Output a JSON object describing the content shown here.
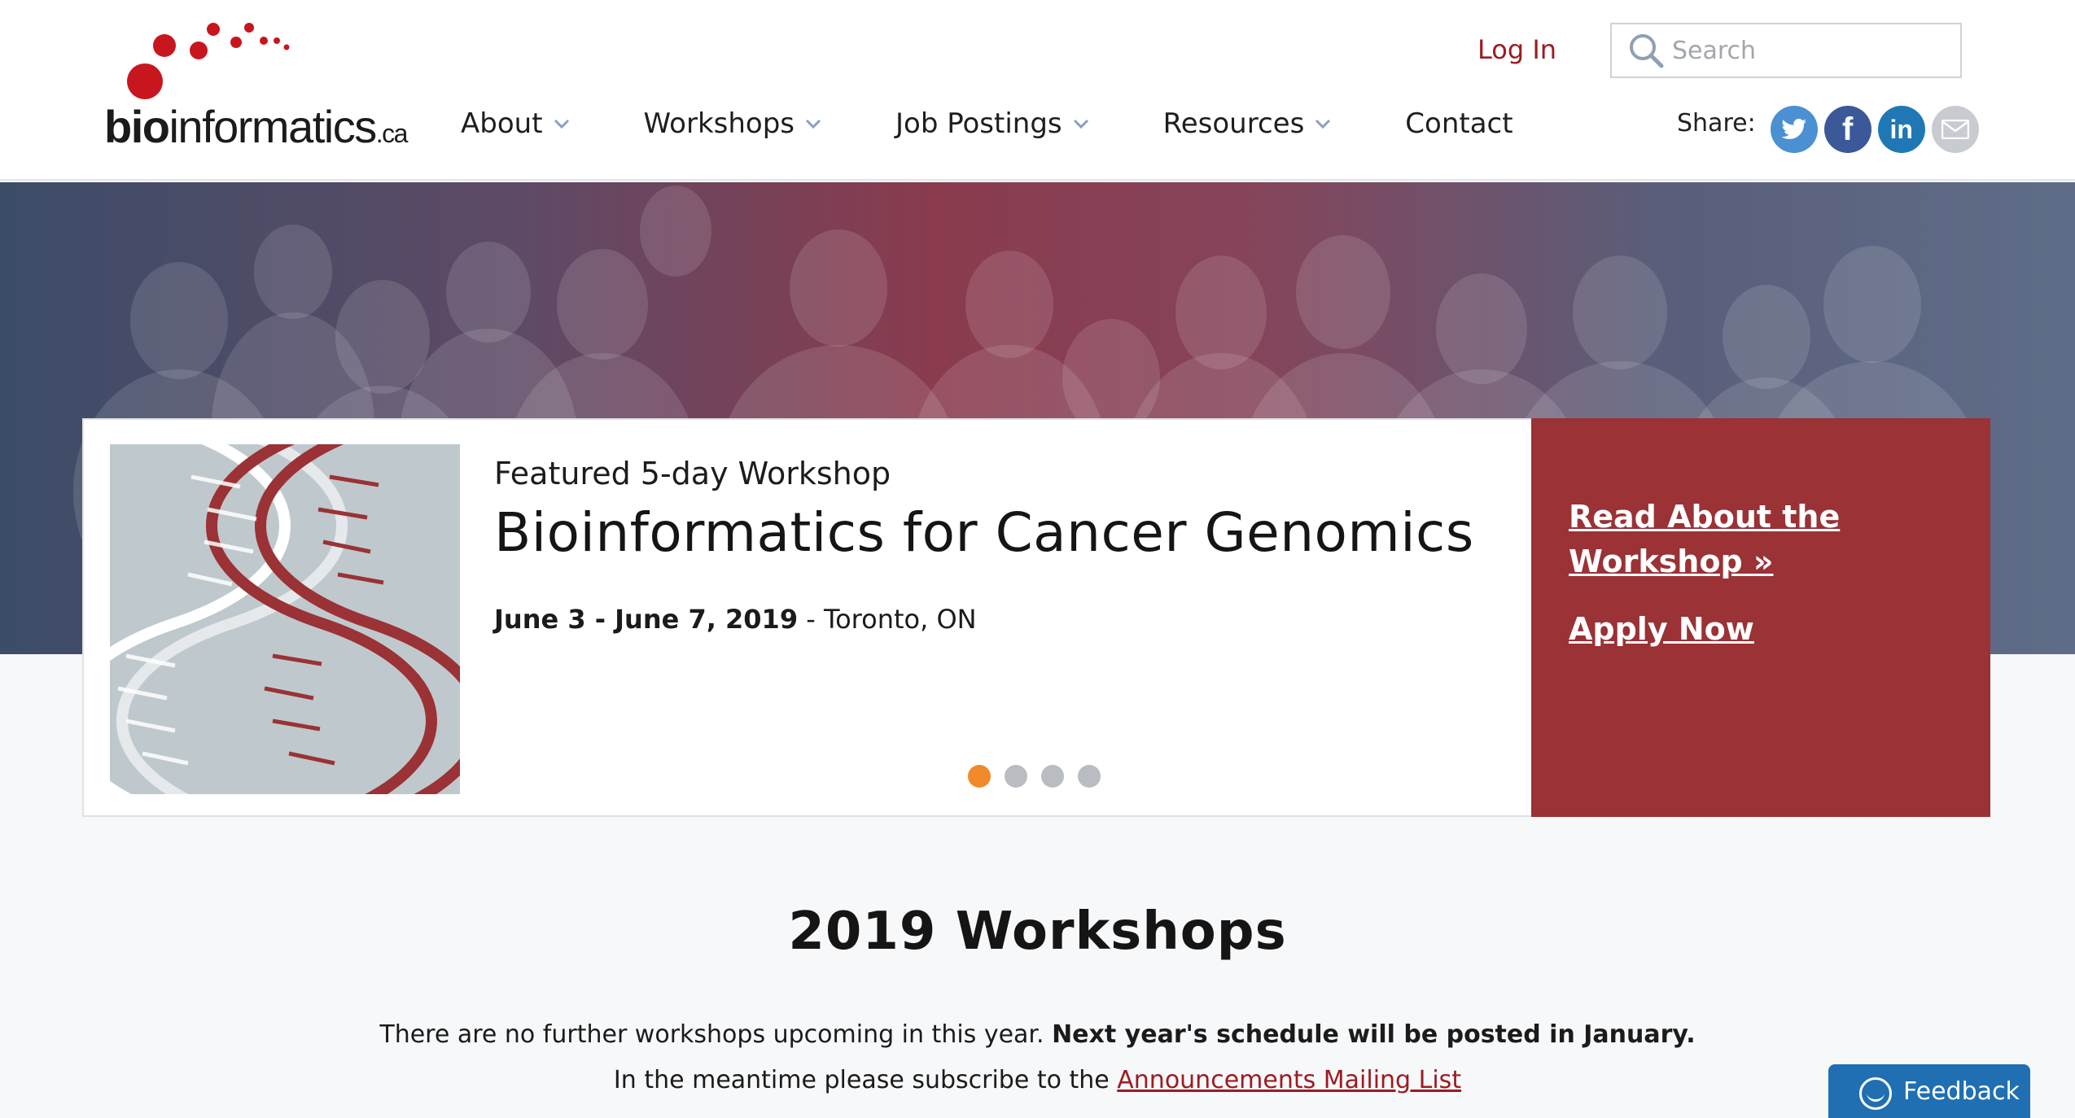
{
  "header": {
    "logo": {
      "bold": "bio",
      "regular": "informatics",
      "suffix": ".ca"
    },
    "login_label": "Log In",
    "search": {
      "placeholder": "Search",
      "value": ""
    },
    "nav": [
      {
        "label": "About",
        "has_dropdown": true
      },
      {
        "label": "Workshops",
        "has_dropdown": true
      },
      {
        "label": "Job Postings",
        "has_dropdown": true
      },
      {
        "label": "Resources",
        "has_dropdown": true
      },
      {
        "label": "Contact",
        "has_dropdown": false
      }
    ],
    "share": {
      "label": "Share:",
      "icons": [
        "twitter-icon",
        "facebook-icon",
        "linkedin-icon",
        "email-icon"
      ],
      "facebook_glyph": "f",
      "linkedin_glyph": "in"
    }
  },
  "featured": {
    "eyebrow": "Featured 5-day Workshop",
    "title": "Bioinformatics for Cancer Genomics",
    "date": "June 3 - June 7, 2019",
    "separator": " - ",
    "location": "Toronto, ON",
    "read_link": "Read About the Workshop »",
    "apply_link": "Apply Now",
    "carousel": {
      "slides": 4,
      "active": 1
    }
  },
  "section": {
    "title": "2019 Workshops",
    "notice_regular": "There are no further workshops upcoming in this year. ",
    "notice_bold": "Next year's schedule will be posted in January.",
    "subscribe_prefix": "In the meantime please subscribe to the ",
    "subscribe_link": "Announcements Mailing List"
  },
  "feedback": {
    "label": "Feedback"
  },
  "colors": {
    "brand_red": "#9b1c22",
    "cta_red": "#9a3236",
    "active_dot": "#f08a2b",
    "feedback_blue": "#1f6fb2"
  }
}
